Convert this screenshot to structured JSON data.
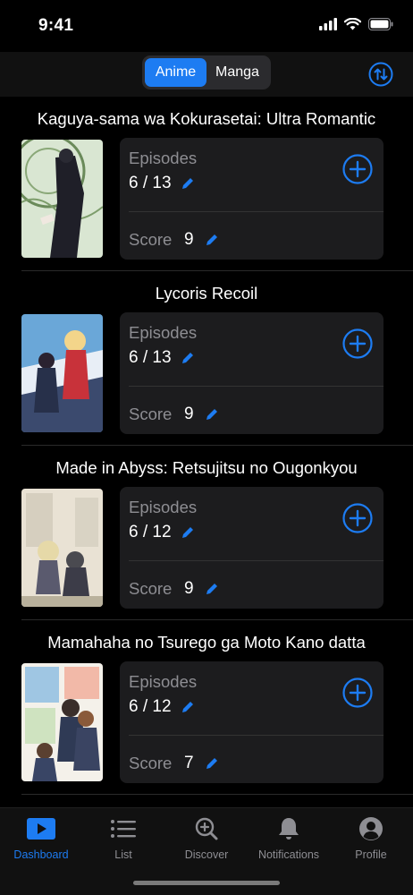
{
  "status": {
    "time": "9:41"
  },
  "segments": [
    {
      "label": "Anime",
      "active": true
    },
    {
      "label": "Manga",
      "active": false
    }
  ],
  "labels": {
    "episodes": "Episodes",
    "score": "Score"
  },
  "items": [
    {
      "title": "Kaguya-sama wa Kokurasetai: Ultra Romantic",
      "episodes": "6 / 13",
      "score": "9"
    },
    {
      "title": "Lycoris Recoil",
      "episodes": "6 / 13",
      "score": "9"
    },
    {
      "title": "Made in Abyss: Retsujitsu no Ougonkyou",
      "episodes": "6 / 12",
      "score": "9"
    },
    {
      "title": "Mamahaha no Tsurego ga Moto Kano datta",
      "episodes": "6 / 12",
      "score": "7"
    }
  ],
  "tabs": [
    {
      "label": "Dashboard",
      "icon": "play-icon",
      "active": true
    },
    {
      "label": "List",
      "icon": "list-icon",
      "active": false
    },
    {
      "label": "Discover",
      "icon": "magnifier-plus-icon",
      "active": false
    },
    {
      "label": "Notifications",
      "icon": "bell-icon",
      "active": false
    },
    {
      "label": "Profile",
      "icon": "person-circle-icon",
      "active": false
    }
  ],
  "colors": {
    "accent": "#1d7cf2",
    "card": "#1c1c1e",
    "secondary_text": "#8e8e93"
  }
}
